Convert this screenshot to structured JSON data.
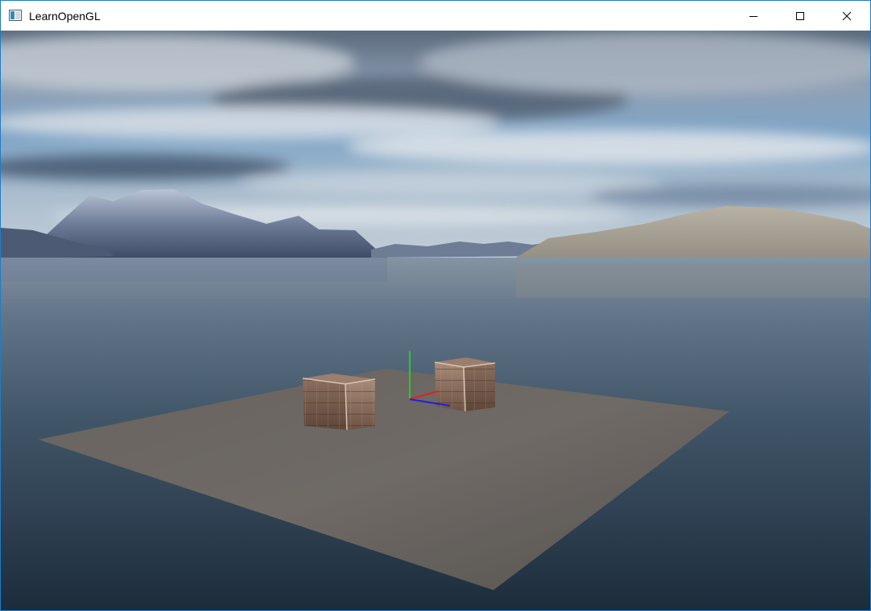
{
  "window": {
    "title": "LearnOpenGL",
    "controls": {
      "minimize": "minimize-icon",
      "maximize": "maximize-icon",
      "close": "close-icon"
    }
  },
  "scene": {
    "objects": [
      "skybox",
      "mountains",
      "water",
      "floor-plane",
      "crate",
      "crate",
      "axis-gizmo"
    ],
    "axis_colors": {
      "x": "#e02020",
      "y": "#20d020",
      "z": "#2020e0"
    }
  }
}
